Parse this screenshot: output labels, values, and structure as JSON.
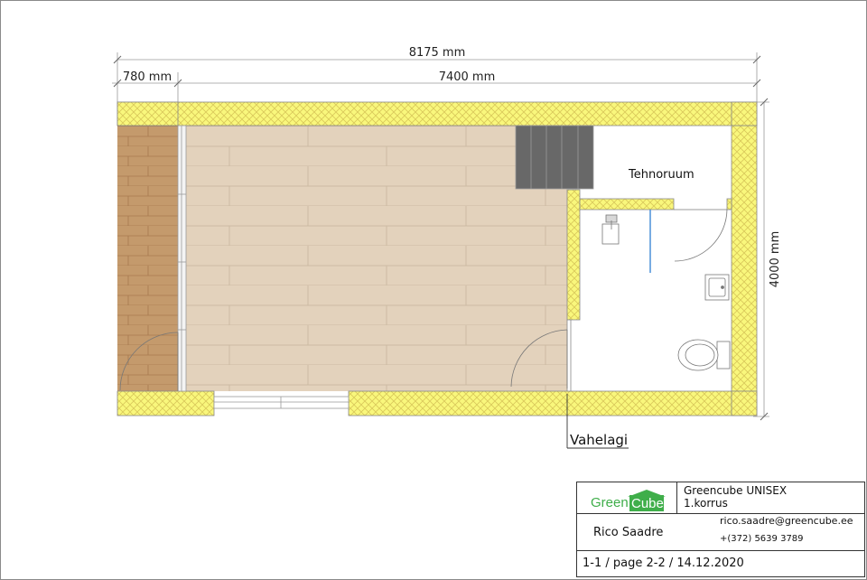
{
  "dimensions": {
    "overall": "8175 mm",
    "terrace": "780 mm",
    "interior": "7400 mm",
    "depth": "4000 mm"
  },
  "rooms": {
    "technical_room": "Tehnoruum"
  },
  "annotations": {
    "ceiling": "Vahelagi"
  },
  "title_block": {
    "logo_green": "Green",
    "logo_cube": "Cube",
    "project_name": "Greencube UNISEX",
    "floor": "1.korrus",
    "author": "Rico Saadre",
    "email": "rico.saadre@greencube.ee",
    "phone": "+(372) 5639 3789",
    "sheet_info": "1-1 / page 2-2 / 14.12.2020"
  },
  "colors": {
    "wall_fill": "#f9f77c",
    "wall_hatch": "#d9c85a",
    "floor_fill": "#e3d2bc",
    "terrace_fill": "#c49a6c",
    "stair_fill": "#686868",
    "logo_green": "#3fae4a"
  }
}
